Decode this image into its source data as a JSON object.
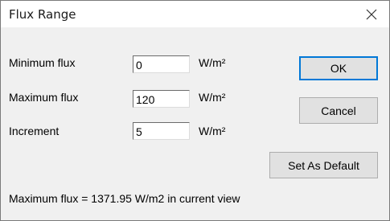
{
  "window": {
    "title": "Flux Range"
  },
  "form": {
    "rows": [
      {
        "label": "Minimum flux",
        "value": "0",
        "unit": "W/m²"
      },
      {
        "label": "Maximum flux",
        "value": "120",
        "unit": "W/m²"
      },
      {
        "label": "Increment",
        "value": "5",
        "unit": "W/m²"
      }
    ]
  },
  "buttons": {
    "ok": "OK",
    "cancel": "Cancel",
    "set_default": "Set As Default"
  },
  "status": {
    "text": "Maximum flux = 1371.95 W/m2 in current view"
  },
  "icons": {
    "close": "close-icon"
  }
}
